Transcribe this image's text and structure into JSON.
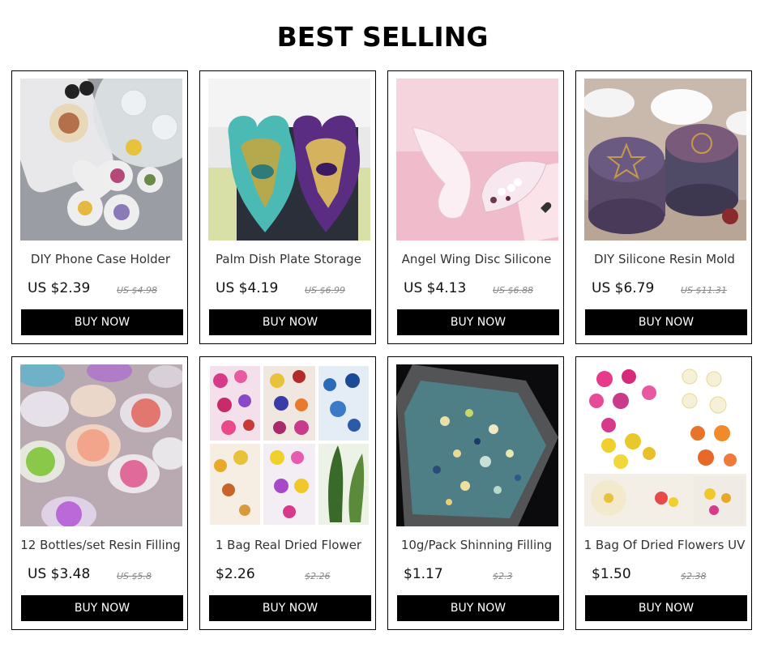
{
  "section": {
    "title": "BEST SELLING"
  },
  "products": [
    {
      "name": "DIY Phone Case Holder",
      "price": "US $2.39",
      "old_price": "US $4.98",
      "button": "BUY NOW",
      "image": "phone-holder-resin-mold"
    },
    {
      "name": "Palm Dish Plate Storage",
      "price": "US $4.19",
      "old_price": "US $6.99",
      "button": "BUY NOW",
      "image": "hamsa-palm-dish"
    },
    {
      "name": "Angel Wing Disc Silicone",
      "price": "US $4.13",
      "old_price": "US $6.88",
      "button": "BUY NOW",
      "image": "angel-wing-dish"
    },
    {
      "name": "DIY Silicone Resin Mold",
      "price": "US $6.79",
      "old_price": "US $11.31",
      "button": "BUY NOW",
      "image": "round-box-resin-mold"
    },
    {
      "name": "12 Bottles/set Resin Filling",
      "price": "US $3.48",
      "old_price": "US $5.8",
      "button": "BUY NOW",
      "image": "fruit-slice-bottles"
    },
    {
      "name": "1 Bag Real Dried Flower",
      "price": "$2.26",
      "old_price": "$2.26",
      "button": "BUY NOW",
      "image": "dried-flowers-bag"
    },
    {
      "name": "10g/Pack Shinning Filling",
      "price": "$1.17",
      "old_price": "$2.3",
      "button": "BUY NOW",
      "image": "glitter-pack"
    },
    {
      "name": "1 Bag Of Dried Flowers UV",
      "price": "$1.50",
      "old_price": "$2.38",
      "button": "BUY NOW",
      "image": "daisy-dried-flowers"
    }
  ]
}
